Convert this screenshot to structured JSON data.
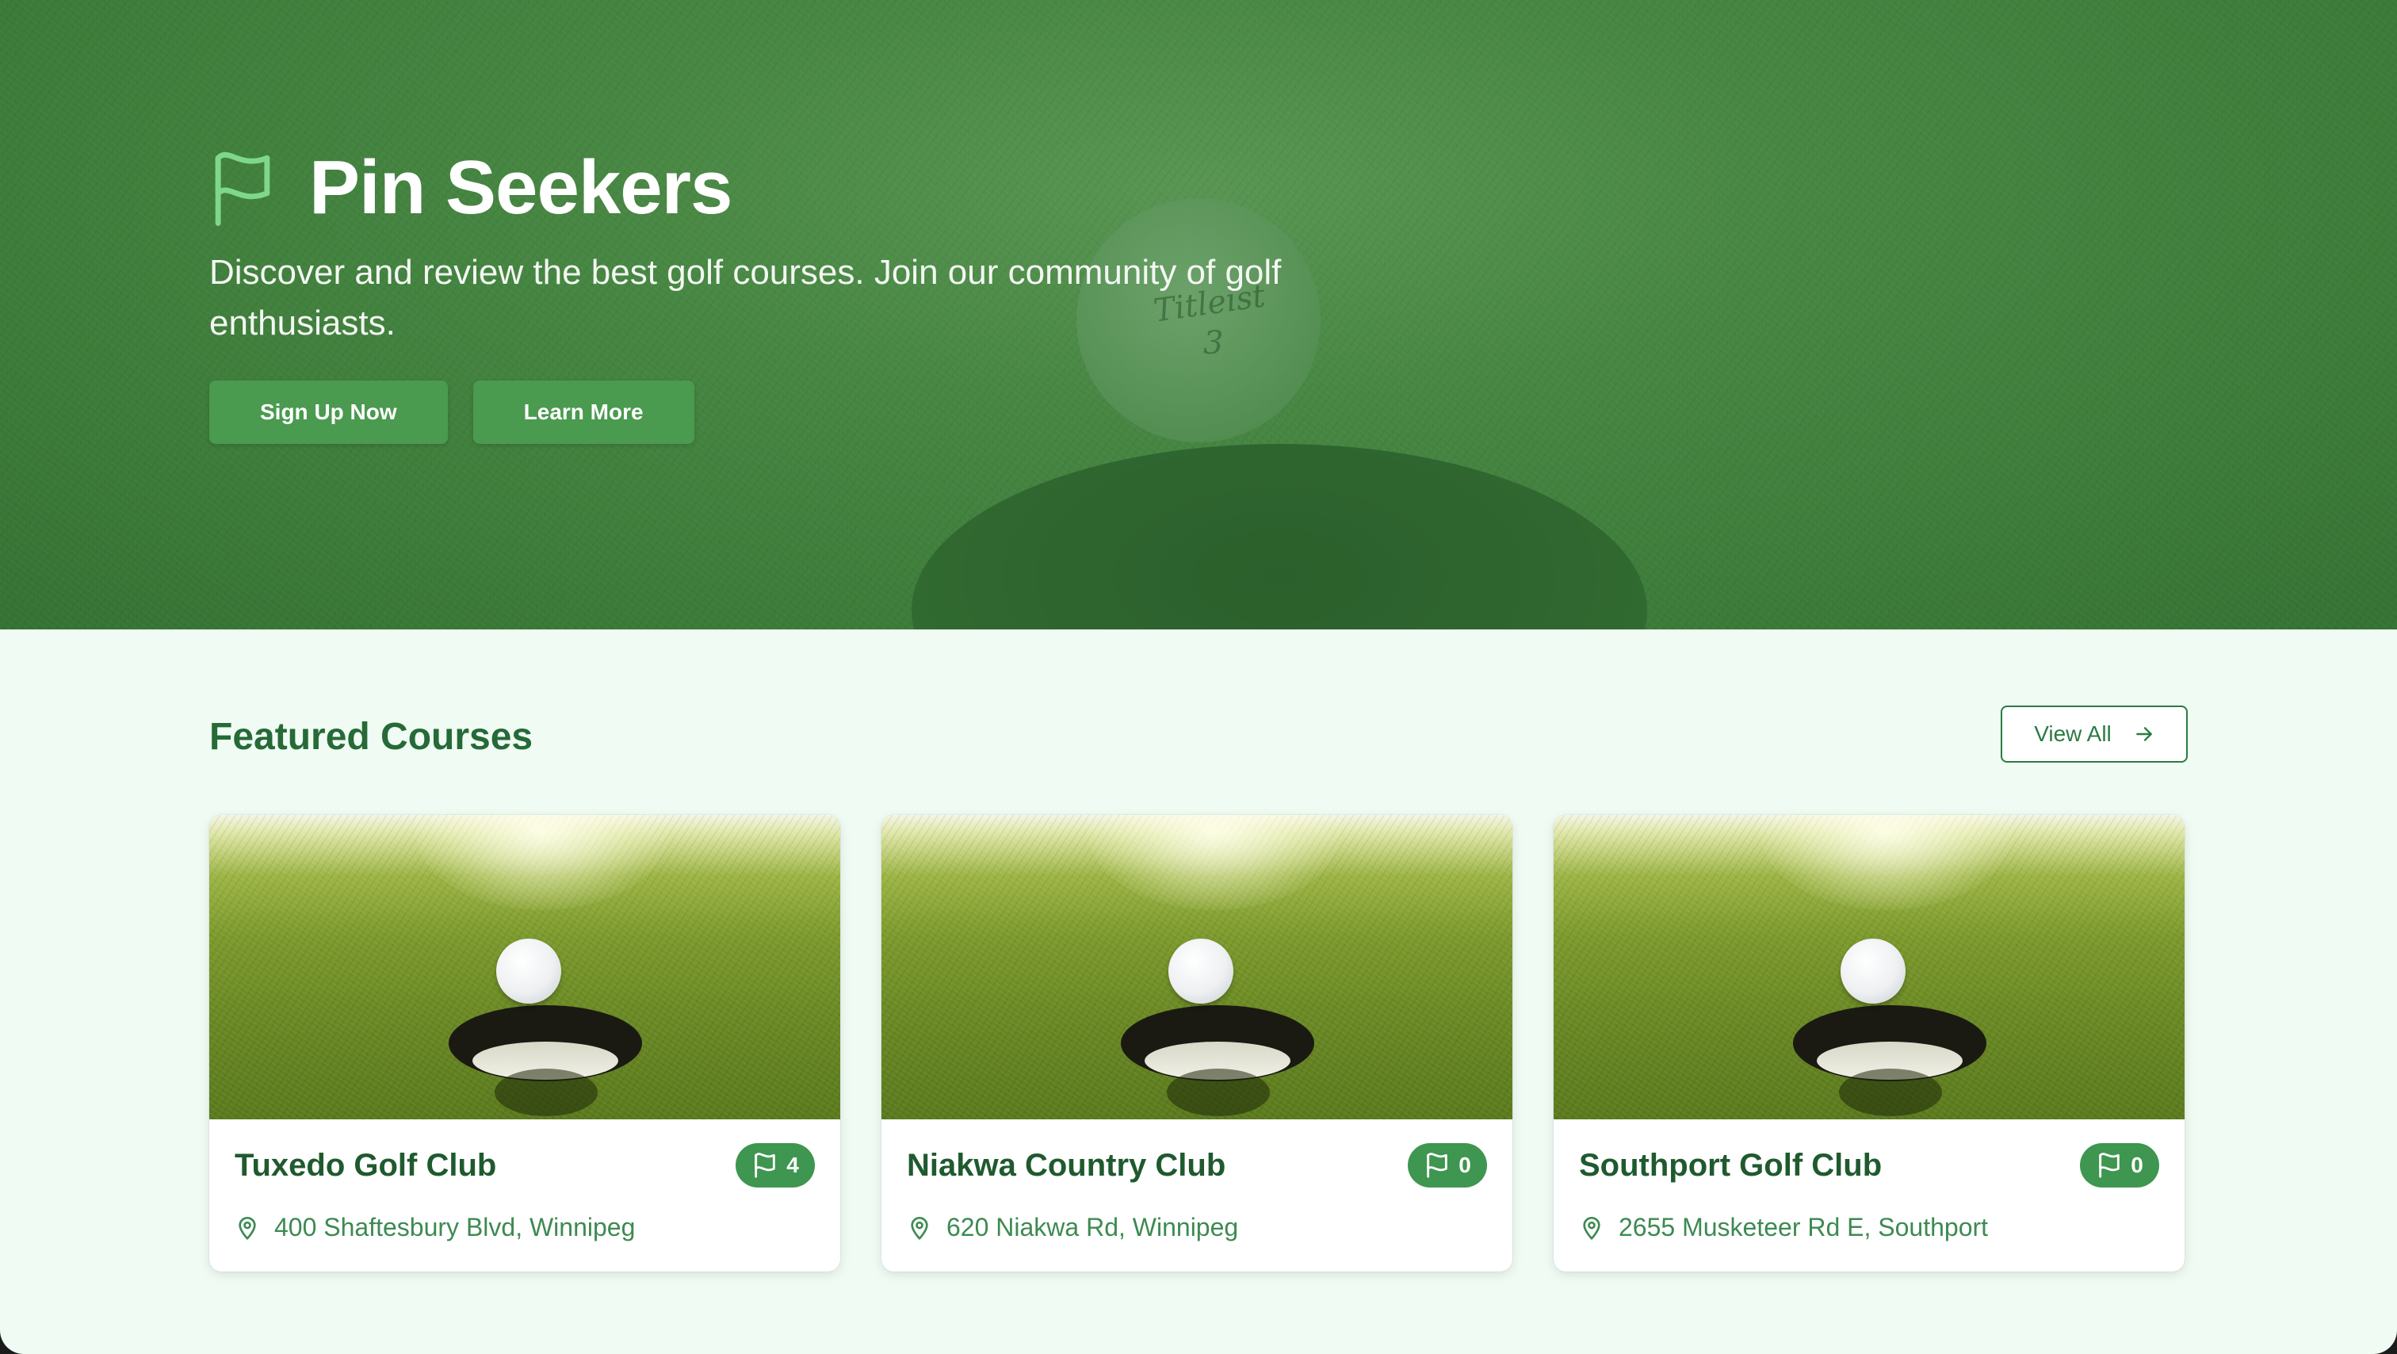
{
  "hero": {
    "brand_icon": "flag-icon",
    "title": "Pin Seekers",
    "description": "Discover and review the best golf courses. Join our community of golf enthusiasts.",
    "background_ball_text": "Titleist",
    "background_ball_number": "3",
    "buttons": {
      "signup_label": "Sign Up Now",
      "learn_label": "Learn More"
    }
  },
  "featured": {
    "title": "Featured Courses",
    "view_all_label": "View All",
    "view_all_icon": "arrow-right-icon",
    "cards": [
      {
        "name": "Tuxedo Golf Club",
        "flag_count": "4",
        "address": "400 Shaftesbury Blvd, Winnipeg"
      },
      {
        "name": "Niakwa Country Club",
        "flag_count": "0",
        "address": "620 Niakwa Rd, Winnipeg"
      },
      {
        "name": "Southport Golf Club",
        "flag_count": "0",
        "address": "2655 Musketeer Rd E, Southport"
      }
    ]
  },
  "colors": {
    "primary_green": "#4a9a4f",
    "badge_green": "#3e9650",
    "heading_green": "#256a37",
    "page_background": "#effbf3",
    "brand_icon_green": "#7ed889"
  }
}
